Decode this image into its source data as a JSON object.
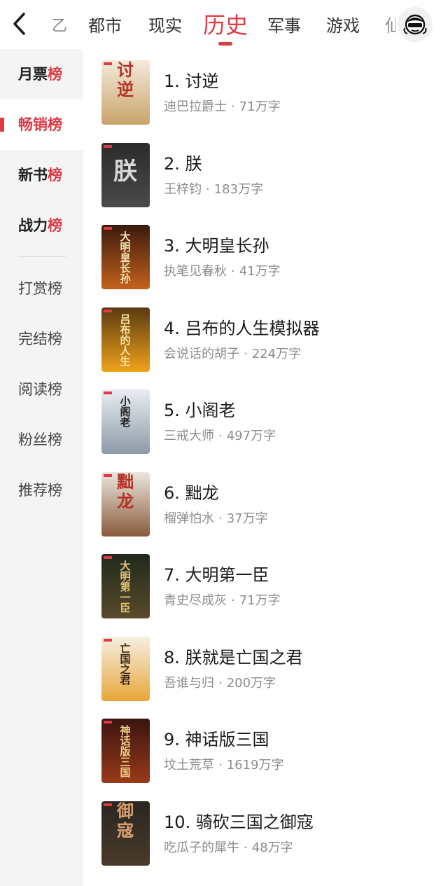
{
  "header": {
    "back_icon": "chevron-left-icon",
    "tabs": [
      {
        "label": "乙"
      },
      {
        "label": "都市"
      },
      {
        "label": "现实"
      },
      {
        "label": "历史"
      },
      {
        "label": "军事"
      },
      {
        "label": "游戏"
      },
      {
        "label": "仙"
      }
    ],
    "active_tab": "历史",
    "avatar_icon": "mascot-avatar-icon",
    "accent_color": "#e03a45"
  },
  "sidebar": {
    "items": [
      {
        "label_main": "月票",
        "label_end": "榜"
      },
      {
        "label_main": "畅销",
        "label_end": "榜"
      },
      {
        "label_main": "新书",
        "label_end": "榜"
      },
      {
        "label_main": "战力",
        "label_end": "榜"
      },
      {
        "label": "打赏榜"
      },
      {
        "label": "完结榜"
      },
      {
        "label": "阅读榜"
      },
      {
        "label": "粉丝榜"
      },
      {
        "label": "推荐榜"
      }
    ],
    "active_index": 1
  },
  "books": [
    {
      "title": "1. 讨逆",
      "author": "迪巴拉爵士",
      "words": "71万字",
      "cover_text": "讨逆",
      "cover_colors": [
        "#f4eadb",
        "#c9a46a",
        "#b5322a"
      ]
    },
    {
      "title": "2. 朕",
      "author": "王梓钧",
      "words": "183万字",
      "cover_text": "朕",
      "cover_colors": [
        "#2b2b2b",
        "#4a4a4a",
        "#d8d8d8"
      ]
    },
    {
      "title": "3. 大明皇长孙",
      "author": "执笔见春秋",
      "words": "41万字",
      "cover_text": "大明皇长孙",
      "cover_colors": [
        "#3a1a0e",
        "#c4621c",
        "#f5e3b0"
      ]
    },
    {
      "title": "4. 吕布的人生模拟器",
      "author": "会说话的胡子",
      "words": "224万字",
      "cover_text": "吕布的人生模拟器",
      "cover_colors": [
        "#5a3a12",
        "#f0a21c",
        "#fbe3a0"
      ]
    },
    {
      "title": "5. 小阁老",
      "author": "三戒大师",
      "words": "497万字",
      "cover_text": "小阁老",
      "cover_colors": [
        "#e9edf1",
        "#8d9aa8",
        "#222222"
      ]
    },
    {
      "title": "6. 黜龙",
      "author": "榴弹怕水",
      "words": "37万字",
      "cover_text": "黜龙",
      "cover_colors": [
        "#ece7df",
        "#8a5a3a",
        "#b5322a"
      ]
    },
    {
      "title": "7. 大明第一臣",
      "author": "青史尽成灰",
      "words": "71万字",
      "cover_text": "大明第一臣",
      "cover_colors": [
        "#1f2a1c",
        "#5a4a2a",
        "#e6c27a"
      ]
    },
    {
      "title": "8. 朕就是亡国之君",
      "author": "吾谁与归",
      "words": "200万字",
      "cover_text": "亡国之君",
      "cover_colors": [
        "#f6efe2",
        "#e8a63a",
        "#3a2a1a"
      ]
    },
    {
      "title": "9. 神话版三国",
      "author": "坟土荒草",
      "words": "1619万字",
      "cover_text": "神话版三国",
      "cover_colors": [
        "#3a1410",
        "#9a3a1a",
        "#f0d28a"
      ]
    },
    {
      "title": "10. 骑砍三国之御寇",
      "author": "吃瓜子的犀牛",
      "words": "48万字",
      "cover_text": "御寇",
      "cover_colors": [
        "#2a2622",
        "#4a3a2a",
        "#d8a070"
      ]
    }
  ]
}
